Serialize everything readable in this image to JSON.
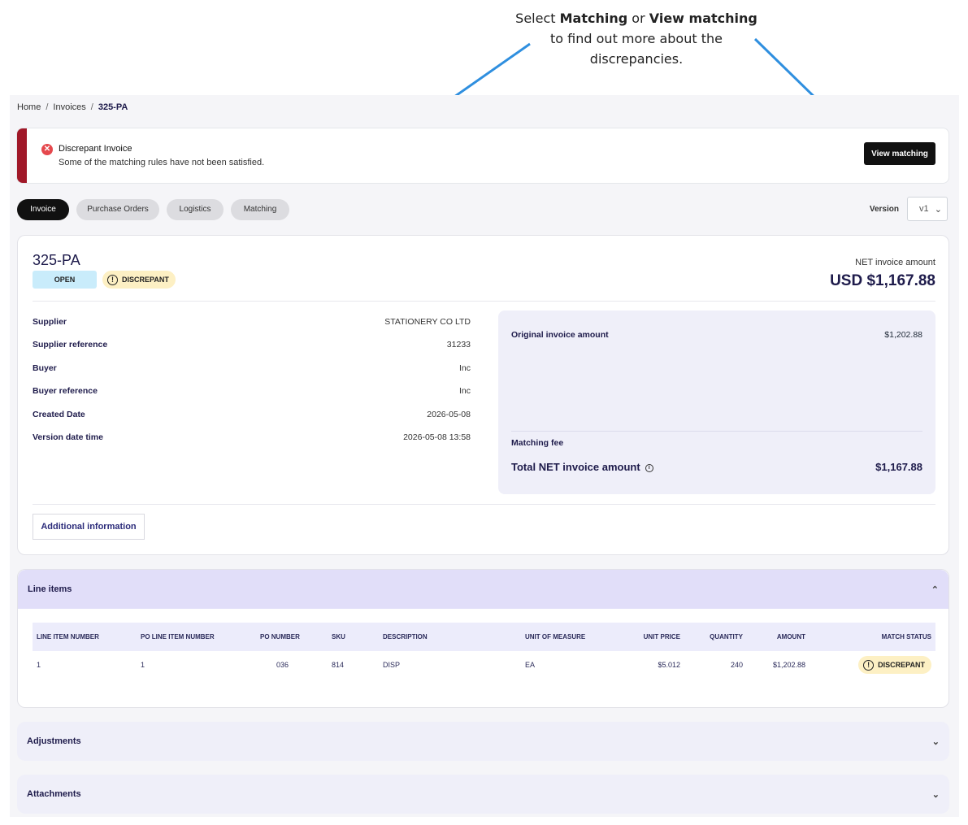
{
  "callout": {
    "line1_pre": "Select ",
    "line1_b1": "Matching",
    "line1_mid": " or ",
    "line1_b2": "View matching",
    "line2": "to find out more about the discrepancies."
  },
  "breadcrumb": {
    "home": "Home",
    "invoices": "Invoices",
    "current": "325-PA",
    "sep": "/"
  },
  "alert": {
    "title": "Discrepant Invoice",
    "message": "Some of the matching rules have not been satisfied.",
    "view_matching_label": "View matching"
  },
  "tabs": [
    {
      "label": "Invoice"
    },
    {
      "label": "Purchase Orders"
    },
    {
      "label": "Logistics"
    },
    {
      "label": "Matching"
    }
  ],
  "version": {
    "label": "Version",
    "value": "v1"
  },
  "invoice": {
    "id": "325-PA",
    "status": "OPEN",
    "match_status": "DISCREPANT",
    "net_label": "NET invoice amount",
    "net_amount": "USD $1,167.88"
  },
  "details": [
    {
      "key": "Supplier",
      "value": "STATIONERY CO LTD"
    },
    {
      "key": "Supplier reference",
      "value": "31233"
    },
    {
      "key": "Buyer",
      "value": "Inc"
    },
    {
      "key": "Buyer reference",
      "value": "Inc"
    },
    {
      "key": "Created Date",
      "value": "2026-05-08"
    },
    {
      "key": "Version date time",
      "value": "2026-05-08 13:58"
    }
  ],
  "summary": {
    "original_label": "Original invoice amount",
    "original_value": "$1,202.88",
    "fee_label": "Matching fee",
    "total_label": "Total NET invoice amount",
    "total_value": "$1,167.88"
  },
  "additional_info_label": "Additional information",
  "line_items": {
    "title": "Line items",
    "columns": [
      "LINE ITEM NUMBER",
      "PO LINE ITEM NUMBER",
      "PO NUMBER",
      "SKU",
      "DESCRIPTION",
      "UNIT OF MEASURE",
      "UNIT PRICE",
      "QUANTITY",
      "AMOUNT",
      "MATCH STATUS"
    ],
    "rows": [
      [
        "1",
        "1",
        "036",
        "814",
        "DISP",
        "EA",
        "$5.012",
        "240",
        "$1,202.88",
        "DISCREPANT"
      ]
    ]
  },
  "adjustments_title": "Adjustments",
  "attachments_title": "Attachments",
  "colors": {
    "accent_dark": "#111111",
    "alert_red": "#a01828",
    "arrow_blue": "#2f8fdf",
    "discrepant_bg": "#fdf0c4",
    "open_bg": "#c9ecfb"
  },
  "icons": [
    "close-circle-icon",
    "warning-icon",
    "info-icon",
    "chevron-down-icon",
    "chevron-up-icon",
    "arrow-icon"
  ]
}
